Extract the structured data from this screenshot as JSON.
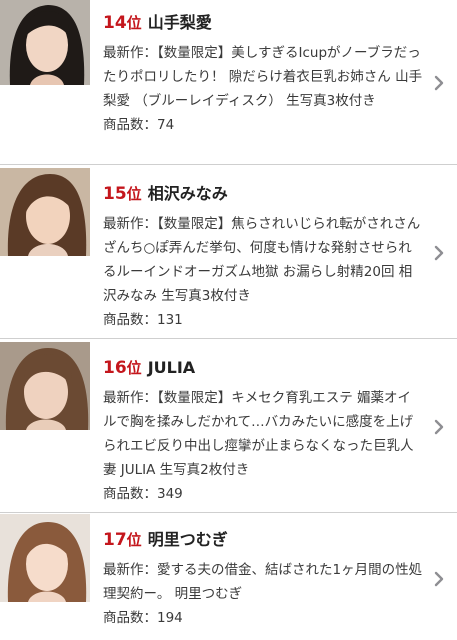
{
  "colors": {
    "rank": "#c4161c",
    "divider": "#cfcfcf",
    "chevron": "#8e8e93"
  },
  "icons": {
    "chevron": "chevron-right-icon",
    "thumbnail": "actress-photo"
  },
  "ranking": [
    {
      "rank": "14",
      "rank_suffix": "位",
      "name": "山手梨愛",
      "latest_label": "最新作：",
      "latest_title": "【数量限定】美しすぎるIcupがノーブラだったりポロリしたり！ 隙だらけ着衣巨乳お姉さん 山手梨愛 （ブルーレイディスク） 生写真3枚付き",
      "count_label": "商品数：",
      "count": "74"
    },
    {
      "rank": "15",
      "rank_suffix": "位",
      "name": "相沢みなみ",
      "latest_label": "最新作：",
      "latest_title": "【数量限定】焦らされいじられ転がされさんざんち○ぽ弄んだ挙句、何度も情けな発射させられるルーインドオーガズム地獄 お漏らし射精20回 相沢みなみ 生写真3枚付き",
      "count_label": "商品数：",
      "count": "131"
    },
    {
      "rank": "16",
      "rank_suffix": "位",
      "name": "JULIA",
      "latest_label": "最新作：",
      "latest_title": "【数量限定】キメセク育乳エステ 媚薬オイルで胸を揉みしだかれて…バカみたいに感度を上げられエビ反り中出し痙攣が止まらなくなった巨乳人妻 JULIA 生写真2枚付き",
      "count_label": "商品数：",
      "count": "349"
    },
    {
      "rank": "17",
      "rank_suffix": "位",
      "name": "明里つむぎ",
      "latest_label": "最新作：",
      "latest_title": "愛する夫の借金、結ばされた1ヶ月間の性処理契約ー。 明里つむぎ",
      "count_label": "商品数：",
      "count": "194"
    }
  ]
}
